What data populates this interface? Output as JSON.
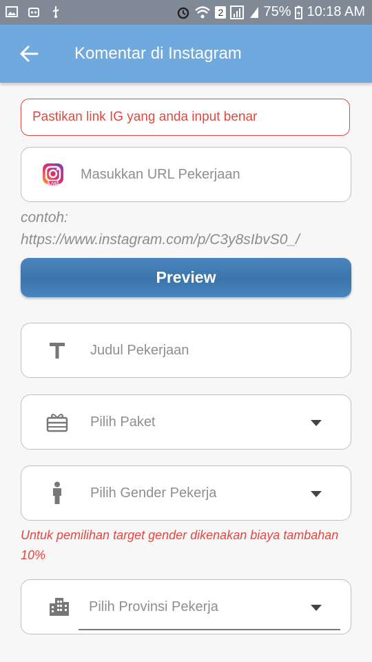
{
  "status_bar": {
    "battery": "75%",
    "time": "10:18 AM",
    "sim_badge": "2"
  },
  "app_bar": {
    "title": "Komentar di Instagram",
    "back_icon": "arrow-back-icon"
  },
  "alert": {
    "text": "Pastikan link IG yang anda input benar",
    "color": "#e0483f"
  },
  "url_input": {
    "placeholder": "Masukkan URL Pekerjaan",
    "icon": "instagram-live-icon"
  },
  "example_hint": {
    "line1": "contoh:",
    "line2": "https://www.instagram.com/p/C3y8sIbvS0_/"
  },
  "preview_button": {
    "label": "Preview"
  },
  "title_input": {
    "placeholder": "Judul Pekerjaan",
    "icon": "text-t-icon"
  },
  "package_select": {
    "placeholder": "Pilih Paket",
    "icon": "gift-box-icon"
  },
  "gender_select": {
    "placeholder": "Pilih Gender Pekerja",
    "icon": "person-icon"
  },
  "gender_note": {
    "text": "Untuk pemilihan target gender dikenakan biaya tambahan 10%"
  },
  "province_select": {
    "placeholder": "Pilih Provinsi Pekerja",
    "icon": "building-icon"
  },
  "colors": {
    "app_bar": "#6fa9dd",
    "accent_red": "#e0483f",
    "button_blue": "#3a74aa"
  }
}
